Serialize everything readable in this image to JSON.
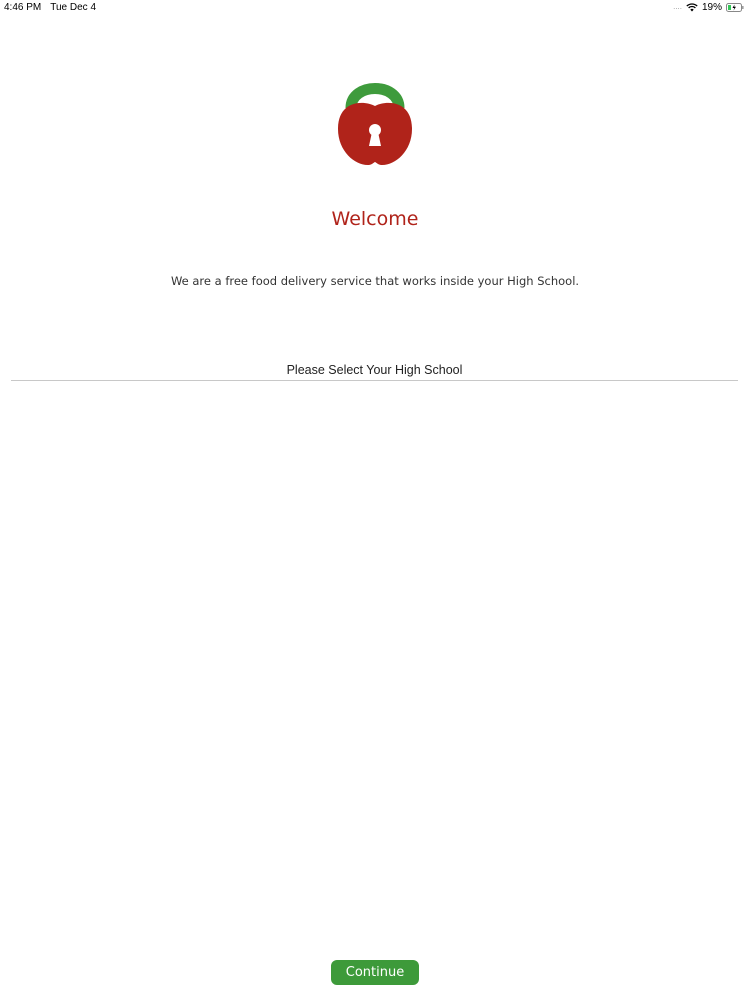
{
  "status_bar": {
    "time": "4:46 PM",
    "date": "Tue Dec 4",
    "signal": "....",
    "battery_percent": "19%",
    "wifi_icon": "wifi-icon",
    "battery_icon": "battery-charging-icon"
  },
  "logo": {
    "icon": "apple-padlock-logo",
    "colors": {
      "shackle": "#3e9b3c",
      "body": "#b0231a",
      "keyhole": "#ffffff"
    }
  },
  "welcome": {
    "title": "Welcome",
    "tagline": "We are a free food delivery service that works inside your High School."
  },
  "school_picker": {
    "placeholder": "Please Select Your High School"
  },
  "actions": {
    "continue_label": "Continue"
  },
  "colors": {
    "accent_red": "#b0231a",
    "accent_green": "#3d9a3a"
  }
}
